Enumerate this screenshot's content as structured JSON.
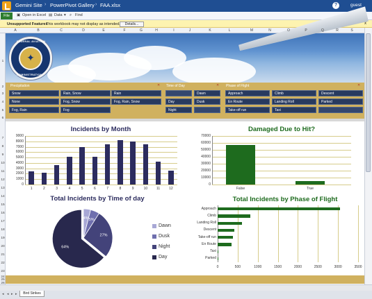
{
  "topbar": {
    "crumbs": [
      "Gemini Site",
      "PowerPivot Gallery",
      "FAA.xlsx"
    ],
    "user": "guest"
  },
  "ribbon": {
    "file_label": "File",
    "open_excel": "Open in Excel",
    "data": "Data",
    "find": "Find"
  },
  "infobar": {
    "title": "Unsupported Features",
    "text": "This workbook may not display as intended.",
    "details_button": "Details...",
    "close": "x"
  },
  "columns": [
    "A",
    "B",
    "C",
    "D",
    "E",
    "F",
    "G",
    "H",
    "I",
    "J",
    "K",
    "L",
    "M",
    "N",
    "O",
    "P",
    "Q",
    "R",
    "S"
  ],
  "rows": [
    "1",
    "2",
    "3",
    "4",
    "5",
    "6",
    "7",
    "8",
    "9",
    "10",
    "11",
    "12",
    "13",
    "14",
    "15",
    "16",
    "17",
    "18",
    "19",
    "20",
    "21",
    "22",
    "23",
    "24",
    "25",
    "26",
    "27",
    "28",
    "29",
    "30",
    "31",
    "32",
    "33"
  ],
  "seal": {
    "top_text": "FEDERAL AVIATION",
    "bottom_text": "ADMINISTRATION"
  },
  "slicers": {
    "precipitation": {
      "title": "Precipitation",
      "items": [
        "Snow",
        "Rain, Snow",
        "Rain",
        "None",
        "Fog, Snow",
        "Fog, Rain, Snow",
        "Fog, Rain",
        "Fog"
      ]
    },
    "time_of_day": {
      "title": "Time of Day",
      "items": [
        "Dawn",
        "Day",
        "Dusk",
        "Night"
      ]
    },
    "phase_of_flight": {
      "title": "Phase of Flight",
      "items": [
        "Approach",
        "Climb",
        "Descent",
        "En Route",
        "Landing Roll",
        "Parked",
        "Take-off run",
        "Taxi"
      ]
    }
  },
  "chart_data": [
    {
      "type": "bar",
      "title": "Incidents by Month",
      "categories": [
        "1",
        "2",
        "3",
        "4",
        "5",
        "6",
        "7",
        "8",
        "9",
        "10",
        "11",
        "12"
      ],
      "values": [
        2500,
        2200,
        3600,
        5200,
        6900,
        5100,
        7500,
        8200,
        8000,
        7400,
        4300,
        2600
      ],
      "ylim": [
        0,
        9000
      ],
      "yticks": [
        "0",
        "1000",
        "2000",
        "3000",
        "4000",
        "5000",
        "6000",
        "7000",
        "8000",
        "9000"
      ],
      "color": "#2c2c5e"
    },
    {
      "type": "bar",
      "title": "Damaged Due to Hit?",
      "categories": [
        "False",
        "True"
      ],
      "values": [
        57000,
        5000
      ],
      "ylim": [
        0,
        70000
      ],
      "yticks": [
        "0",
        "10000",
        "20000",
        "30000",
        "40000",
        "50000",
        "60000",
        "70000"
      ],
      "color": "#1e6b1e"
    },
    {
      "type": "pie",
      "title": "Total Incidents by Time of day",
      "labels": [
        "Dawn",
        "Dusk",
        "Night",
        "Day"
      ],
      "values": [
        4,
        5,
        27,
        64
      ],
      "slice_labels": [
        "4%",
        "5%",
        "27%",
        "64%"
      ],
      "colors": [
        "#a8a8d6",
        "#6f6fae",
        "#43437a",
        "#28284d"
      ]
    },
    {
      "type": "bar",
      "title": "Total Incidents by Phase of Flight",
      "categories": [
        "Approach",
        "Climb",
        "Landing Roll",
        "Descent",
        "Take-off run",
        "En Route",
        "Taxi",
        "Parked"
      ],
      "values": [
        3050,
        820,
        600,
        420,
        380,
        340,
        20,
        10
      ],
      "xlim": [
        0,
        3500
      ],
      "xticks": [
        "0",
        "500",
        "1000",
        "1500",
        "2000",
        "2500",
        "3000",
        "3500"
      ],
      "color": "#1e6b1e"
    }
  ],
  "sheet_tab": "Bird Strikes"
}
